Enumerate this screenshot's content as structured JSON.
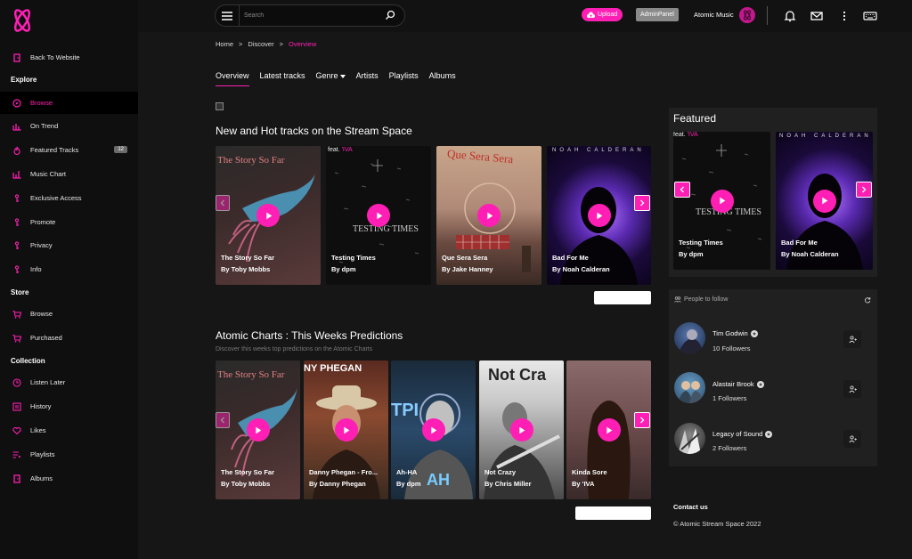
{
  "sidebar": {
    "back": "Back To Website",
    "sections": {
      "explore": "Explore",
      "store": "Store",
      "collection": "Collection"
    },
    "explore_items": [
      {
        "label": "Browse",
        "icon": "compass-icon"
      },
      {
        "label": "On Trend",
        "icon": "bar-chart-icon"
      },
      {
        "label": "Featured Tracks",
        "icon": "fire-icon",
        "badge": "12"
      },
      {
        "label": "Music Chart",
        "icon": "chart-icon"
      },
      {
        "label": "Exclusive Access",
        "icon": "key-icon"
      },
      {
        "label": "Promote",
        "icon": "key-icon"
      },
      {
        "label": "Privacy",
        "icon": "key-icon"
      },
      {
        "label": "Info",
        "icon": "key-icon"
      }
    ],
    "store_items": [
      {
        "label": "Browse",
        "icon": "cart-icon"
      },
      {
        "label": "Purchased",
        "icon": "cart-icon"
      }
    ],
    "collection_items": [
      {
        "label": "Listen Later",
        "icon": "clock-icon"
      },
      {
        "label": "History",
        "icon": "history-icon"
      },
      {
        "label": "Likes",
        "icon": "heart-icon"
      },
      {
        "label": "Playlists",
        "icon": "playlist-icon"
      },
      {
        "label": "Albums",
        "icon": "album-icon"
      }
    ]
  },
  "header": {
    "search_placeholder": "Search",
    "upload": "Upload",
    "admin": "AdminPanel",
    "user": "Atomic Music"
  },
  "breadcrumb": {
    "home": "Home",
    "sep": ">",
    "discover": "Discover",
    "current": "Overview"
  },
  "tabs": [
    "Overview",
    "Latest tracks",
    "Genre",
    "Artists",
    "Playlists",
    "Albums"
  ],
  "section1": {
    "title": "New and Hot tracks on the Stream Space",
    "cards": [
      {
        "title": "The Story So Far",
        "artist": "By Toby Mobbs",
        "overlay": "The Story So Far"
      },
      {
        "title": "Testing Times",
        "artist": "By dpm",
        "overlay": "TESTING TIMES"
      },
      {
        "title": "Que Sera Sera",
        "artist": "By Jake Hanney",
        "overlay": "Que Sera Sera"
      },
      {
        "title": "Bad For Me",
        "artist": "By Noah Calderan",
        "overlay": "NOAH CALDERAN"
      }
    ]
  },
  "section2": {
    "title": "Atomic Charts : This Weeks Predictions",
    "subtitle": "Discover this weeks top predictions on the Atomic Charts",
    "cards": [
      {
        "title": "The Story So Far",
        "artist": "By Toby Mobbs",
        "overlay": "The Story So Far"
      },
      {
        "title": "Danny Phegan - Fro...",
        "artist": "By Danny Phegan",
        "overlay": "NY PHEGAN"
      },
      {
        "title": "Ah-HA",
        "artist": "By dpm",
        "overlay": "TPI"
      },
      {
        "title": "Not Crazy",
        "artist": "By Chris Miller",
        "overlay": "Not Cra"
      },
      {
        "title": "Kinda Sore",
        "artist": "By 'IVA",
        "overlay": ""
      }
    ]
  },
  "featured": {
    "title": "Featured",
    "cards": [
      {
        "title": "Testing Times",
        "artist": "By dpm",
        "overlay": "TESTING TIMES"
      },
      {
        "title": "Bad For Me",
        "artist": "By Noah Calderan",
        "overlay": "NOAH CALDERAN"
      }
    ]
  },
  "people": {
    "heading": "People to follow",
    "list": [
      {
        "name": "Tim Godwin",
        "followers": "10 Followers"
      },
      {
        "name": "Alastair Brook",
        "followers": "1 Followers"
      },
      {
        "name": "Legacy of Sound",
        "followers": "2 Followers"
      }
    ]
  },
  "footer": {
    "contact": "Contact us",
    "copyright": "© Atomic Stream Space 2022"
  },
  "colors": {
    "accent": "#ff1fb4",
    "bg": "#161616",
    "sidebar": "#0f0f0f",
    "panel": "#202020"
  }
}
